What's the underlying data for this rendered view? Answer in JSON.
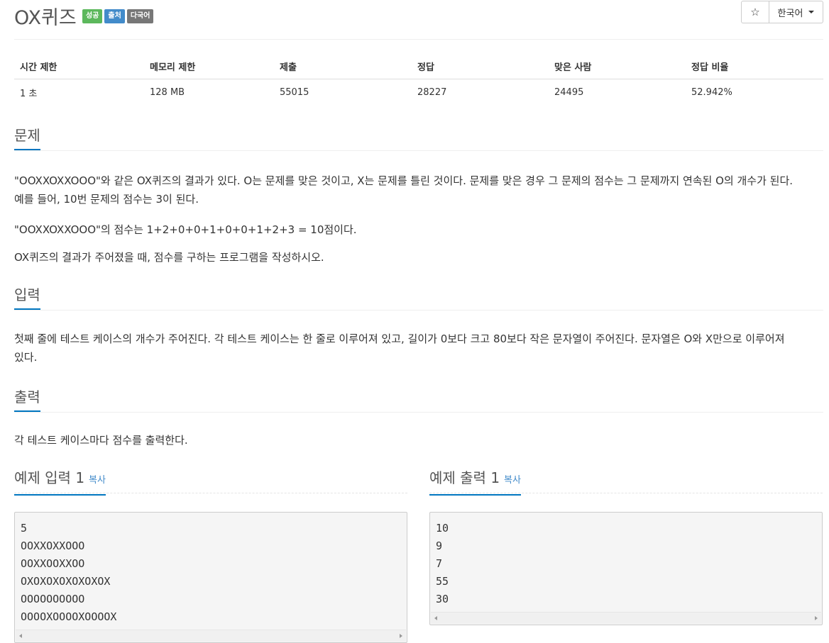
{
  "header": {
    "title": "OX퀴즈",
    "badges": [
      "성공",
      "출처",
      "다국어"
    ],
    "star_glyph": "☆",
    "language": "한국어"
  },
  "stats": {
    "headers": [
      "시간 제한",
      "메모리 제한",
      "제출",
      "정답",
      "맞은 사람",
      "정답 비율"
    ],
    "values": [
      "1 초",
      "128 MB",
      "55015",
      "28227",
      "24495",
      "52.942%"
    ]
  },
  "problem": {
    "heading": "문제",
    "lines": [
      "\"OOXXOXXOOO\"와 같은 OX퀴즈의 결과가 있다. O는 문제를 맞은 것이고, X는 문제를 틀린 것이다. 문제를 맞은 경우 그 문제의 점수는 그 문제까지 연속된 O의 개수가 된다.",
      "예를 들어, 10번 문제의 점수는 3이 된다.",
      "\"OOXXOXXOOO\"의 점수는 1+2+0+0+1+0+0+1+2+3 = 10점이다.",
      "OX퀴즈의 결과가 주어졌을 때, 점수를 구하는 프로그램을 작성하시오."
    ]
  },
  "input": {
    "heading": "입력",
    "lines": [
      "첫째 줄에 테스트 케이스의 개수가 주어진다. 각 테스트 케이스는 한 줄로 이루어져 있고, 길이가 0보다 크고 80보다 작은 문자열이 주어진다. 문자열은 O와 X만으로 이루어져",
      "있다."
    ]
  },
  "output": {
    "heading": "출력",
    "text": "각 테스트 케이스마다 점수를 출력한다."
  },
  "sample_input": {
    "heading": "예제 입력 1",
    "copy_label": "복사",
    "lines": [
      "5",
      "OOXXOXXOOO",
      "OOXXOOXXOO",
      "OXOXOXOXOXOXOX",
      "OOOOOOOOOO",
      "OOOOXOOOOXOOOOX"
    ]
  },
  "sample_output": {
    "heading": "예제 출력 1",
    "copy_label": "복사",
    "lines": [
      "10",
      "9",
      "7",
      "55",
      "30"
    ]
  }
}
